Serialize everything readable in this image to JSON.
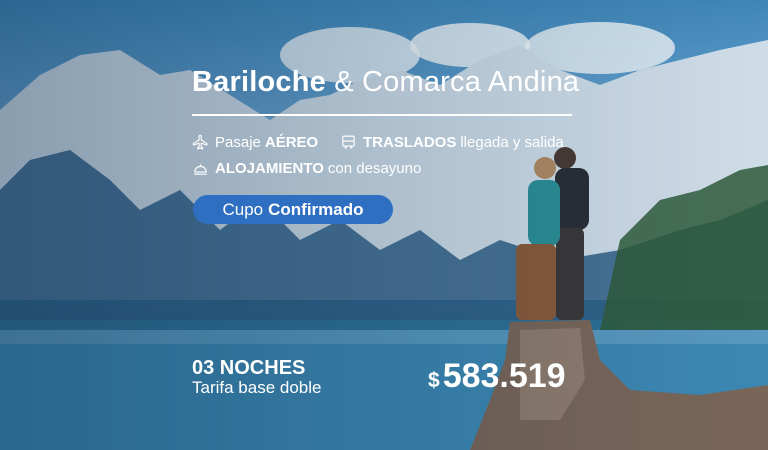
{
  "title": {
    "bold": "Bariloche",
    "rest": " & Comarca Andina"
  },
  "features": [
    {
      "icon": "plane-icon",
      "pre": "Pasaje",
      "bold": "AÉREO",
      "post": ""
    },
    {
      "icon": "bus-icon",
      "pre": "",
      "bold": "TRASLADOS",
      "post": "llegada y salida"
    },
    {
      "icon": "bell-icon",
      "pre": "",
      "bold": "ALOJAMIENTO",
      "post": "con desayuno"
    }
  ],
  "badge": {
    "light": "Cupo",
    "bold": "Confirmado",
    "color": "#2e6fc2"
  },
  "nights": "03 NOCHES",
  "tarifa": "Tarifa base doble",
  "price": {
    "currency": "$",
    "value": "583.519"
  }
}
